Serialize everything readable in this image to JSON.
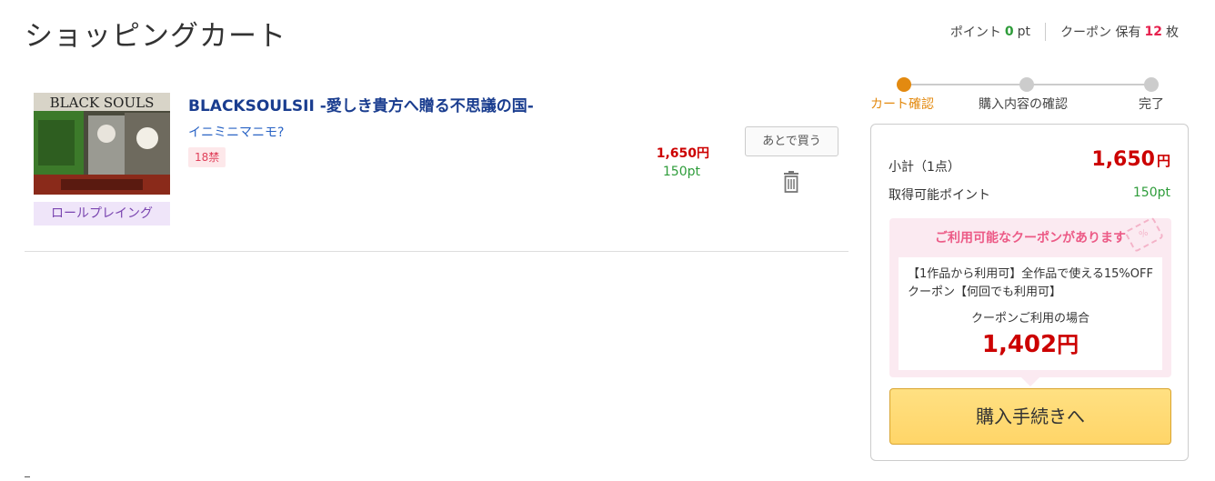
{
  "header": {
    "title": "ショッピングカート",
    "points_label": "ポイント",
    "points_value": "0",
    "points_unit": "pt",
    "coupon_label": "クーポン 保有",
    "coupon_value": "12",
    "coupon_unit": "枚"
  },
  "cart": {
    "items": [
      {
        "thumbnail_text": "BLACK SOULS",
        "genre": "ロールプレイング",
        "title": "BLACKSOULSII -愛しき貴方へ贈る不思議の国-",
        "circle": "イニミニマニモ?",
        "age_rating": "18禁",
        "price": "1,650円",
        "points": "150pt",
        "later_button": "あとで買う",
        "delete_icon": "trash-icon"
      }
    ]
  },
  "steps": [
    {
      "label": "カート確認",
      "active": true
    },
    {
      "label": "購入内容の確認",
      "active": false
    },
    {
      "label": "完了",
      "active": false
    }
  ],
  "summary": {
    "subtotal_label": "小計（1点）",
    "subtotal_value": "1,650",
    "subtotal_unit": "円",
    "points_label": "取得可能ポイント",
    "points_value": "150pt",
    "coupon": {
      "heading": "ご利用可能なクーポンがあります",
      "ticket_text": "%",
      "description": "【1作品から利用可】全作品で使える15%OFFクーポン【何回でも利用可】",
      "when_label": "クーポンご利用の場合",
      "price": "1,402",
      "unit": "円"
    },
    "checkout_button": "購入手続きへ"
  },
  "colors": {
    "accent_orange": "#e38a10",
    "price_red": "#cc0000",
    "points_green": "#2e9c3a",
    "coupon_pink": "#ec5a86",
    "button_yellow": "#ffd568"
  }
}
